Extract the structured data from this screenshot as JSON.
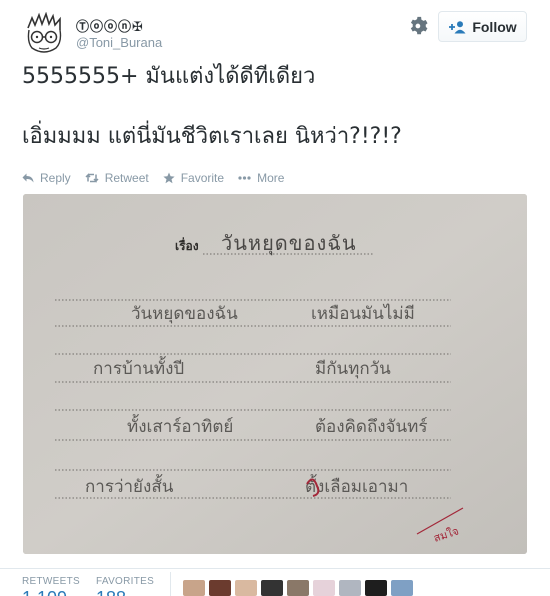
{
  "header": {
    "display_name": "Ⓣⓞⓞⓝ✠",
    "handle": "@Toni_Burana",
    "follow_label": "Follow"
  },
  "tweet": {
    "line1": "5555555+ มันแต่งได้ดีทีเดียว",
    "line2": "เอิ่มมมม แต่นี่มันชีวิตเราเลย นิหว่า?!?!?"
  },
  "actions": {
    "reply": "Reply",
    "retweet": "Retweet",
    "favorite": "Favorite",
    "more": "More"
  },
  "photo": {
    "heading_label": "เรื่อง",
    "title": "วันหยุดของฉัน",
    "rows": [
      {
        "left": "วันหยุดของฉัน",
        "right": "เหมือนมันไม่มี"
      },
      {
        "left": "การบ้านทั้งปี",
        "right": "มีกันทุกวัน"
      },
      {
        "left": "ทั้งเสาร์อาทิตย์",
        "right": "ต้องคิดถึงจันทร์"
      },
      {
        "left": "การว่ายังสั้น",
        "right": "ตั้งเลือมเอามา"
      }
    ],
    "teacher_signature": "สมใจ"
  },
  "stats": {
    "retweets_label": "RETWEETS",
    "retweets_value": "1,109",
    "favorites_label": "FAVORITES",
    "favorites_value": "188"
  },
  "colors": {
    "link_blue": "#2b7bb9",
    "meta_gray": "#8899a6",
    "text_dark": "#292f33",
    "paper": "#cac7c2",
    "ink_red": "#a3283a"
  }
}
